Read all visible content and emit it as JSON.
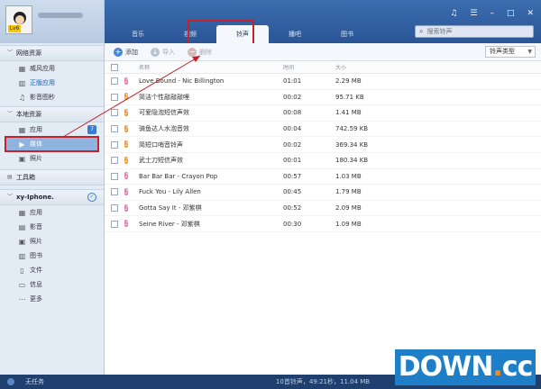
{
  "sidebar": {
    "avatar_badge": "Lv6",
    "sections": [
      {
        "label": "网络资源",
        "items": [
          {
            "label": "威风应用",
            "icon": "apps-icon"
          },
          {
            "label": "正版应用",
            "icon": "store-icon",
            "link": true
          },
          {
            "label": "影音图秒",
            "icon": "music-icon"
          }
        ]
      },
      {
        "label": "本地资源",
        "items": [
          {
            "label": "应用",
            "icon": "apps-icon",
            "count": "7"
          },
          {
            "label": "媒体",
            "icon": "media-icon",
            "selected": true
          },
          {
            "label": "照片",
            "icon": "photo-icon"
          }
        ]
      }
    ],
    "toolbox_label": "工具箱",
    "device_name": "xy-Iphone.",
    "device_items": [
      {
        "label": "应用",
        "icon": "apps-icon"
      },
      {
        "label": "影音",
        "icon": "video-icon"
      },
      {
        "label": "照片",
        "icon": "photo-icon"
      },
      {
        "label": "图书",
        "icon": "book-icon"
      },
      {
        "label": "文件",
        "icon": "file-icon"
      },
      {
        "label": "信息",
        "icon": "message-icon"
      },
      {
        "label": "更多",
        "icon": "more-icon"
      }
    ],
    "footer_label": "无任务"
  },
  "header": {
    "tabs": [
      {
        "label": "音乐"
      },
      {
        "label": "视频"
      },
      {
        "label": "铃声",
        "active": true
      },
      {
        "label": "播吧"
      },
      {
        "label": "图书"
      }
    ],
    "search_placeholder": "搜索铃声"
  },
  "toolbar": {
    "add_label": "添加",
    "import_label": "导入",
    "delete_label": "删除",
    "ringtone_type": "铃声类型"
  },
  "table": {
    "columns": {
      "name": "名称",
      "time": "时间",
      "size": "大小"
    },
    "rows": [
      {
        "name": "Love Bound - Nic Billington",
        "time": "01:01",
        "size": "2.29 MB",
        "color": "pink"
      },
      {
        "name": "简洁个性敲敲敲哩",
        "time": "00:02",
        "size": "95.71 KB",
        "color": "orange"
      },
      {
        "name": "可爱隐泡短信声效",
        "time": "00:08",
        "size": "1.41 MB",
        "color": "orange"
      },
      {
        "name": "骑鱼达人水泡音效",
        "time": "00:04",
        "size": "742.59 KB",
        "color": "orange"
      },
      {
        "name": "简短口哨音铃声",
        "time": "00:02",
        "size": "369.34 KB",
        "color": "orange"
      },
      {
        "name": "武士刀短信声效",
        "time": "00:01",
        "size": "180.34 KB",
        "color": "orange"
      },
      {
        "name": "Bar Bar Bar - Crayon Pop",
        "time": "00:57",
        "size": "1.03 MB",
        "color": "pink"
      },
      {
        "name": "Fuck You - Lily Allen",
        "time": "00:45",
        "size": "1.79 MB",
        "color": "pink"
      },
      {
        "name": "Gotta Say It - 邓紫棋",
        "time": "00:52",
        "size": "2.09 MB",
        "color": "pink"
      },
      {
        "name": "Seine River - 邓紫棋",
        "time": "00:30",
        "size": "1.09 MB",
        "color": "pink"
      }
    ]
  },
  "status": {
    "text": "10首铃声，49:21秒，11.04 MB"
  },
  "watermark": {
    "text_main": "DOWN",
    "text_dot": ".",
    "text_tail": "cc"
  },
  "colors": {
    "header_blue": "#2f5fa4",
    "sidebar_bg": "#e3ebf5",
    "highlight_red": "#c4222a"
  }
}
